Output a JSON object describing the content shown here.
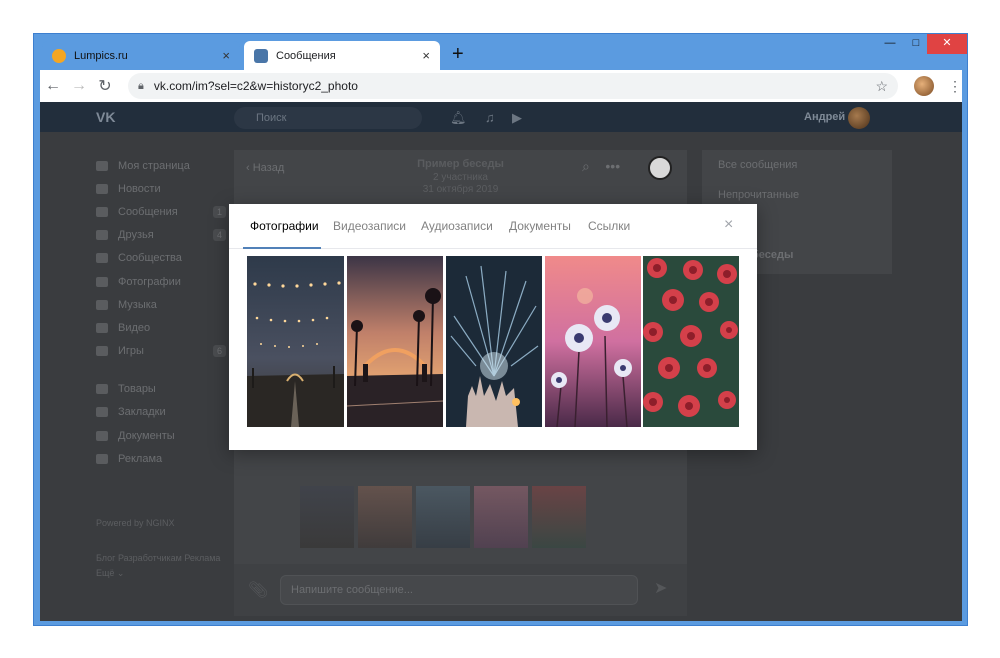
{
  "browser": {
    "tabs": [
      {
        "label": "Lumpics.ru",
        "close": "×"
      },
      {
        "label": "Сообщения",
        "close": "×"
      }
    ],
    "new_tab": "+",
    "url": "vk.com/im?sel=c2&w=historyc2_photo",
    "window_controls": {
      "minimize": "—",
      "maximize": "□",
      "close": "✕"
    },
    "accent": "#5b9be0"
  },
  "vk_header": {
    "logo": "VK",
    "search_placeholder": "Поиск",
    "user_name": "Андрей"
  },
  "left_nav": {
    "items": [
      {
        "label": "Моя страница",
        "count": ""
      },
      {
        "label": "Новости",
        "count": ""
      },
      {
        "label": "Сообщения",
        "count": "1"
      },
      {
        "label": "Друзья",
        "count": "4"
      },
      {
        "label": "Сообщества",
        "count": ""
      },
      {
        "label": "Фотографии",
        "count": ""
      },
      {
        "label": "Музыка",
        "count": ""
      },
      {
        "label": "Видео",
        "count": ""
      },
      {
        "label": "Игры",
        "count": "6"
      }
    ],
    "items2": [
      {
        "label": "Товары"
      },
      {
        "label": "Закладки"
      },
      {
        "label": "Документы"
      },
      {
        "label": "Реклама"
      }
    ],
    "powered": "Powered by NGINX",
    "footer": "Блог  Разработчикам  Реклама  Ещё ⌄"
  },
  "chat": {
    "back": "Назад",
    "title": "Пример беседы",
    "members": "2 участника",
    "date": "31 октября 2019",
    "composer_placeholder": "Напишите сообщение..."
  },
  "right_panel": {
    "items": [
      "Все сообщения",
      "Непрочитанные",
      "",
      "беседы"
    ]
  },
  "modal": {
    "tabs": [
      "Фотографии",
      "Видеозаписи",
      "Аудиозаписи",
      "Документы",
      "Ссылки"
    ],
    "active_tab": "Фотографии",
    "close": "×",
    "photos": [
      {
        "name": "city-lights-photo"
      },
      {
        "name": "palm-arch-sunset-photo"
      },
      {
        "name": "fireworks-castle-photo"
      },
      {
        "name": "daisies-sunset-photo"
      },
      {
        "name": "red-roses-photo"
      }
    ],
    "accent": "#5181b8"
  }
}
